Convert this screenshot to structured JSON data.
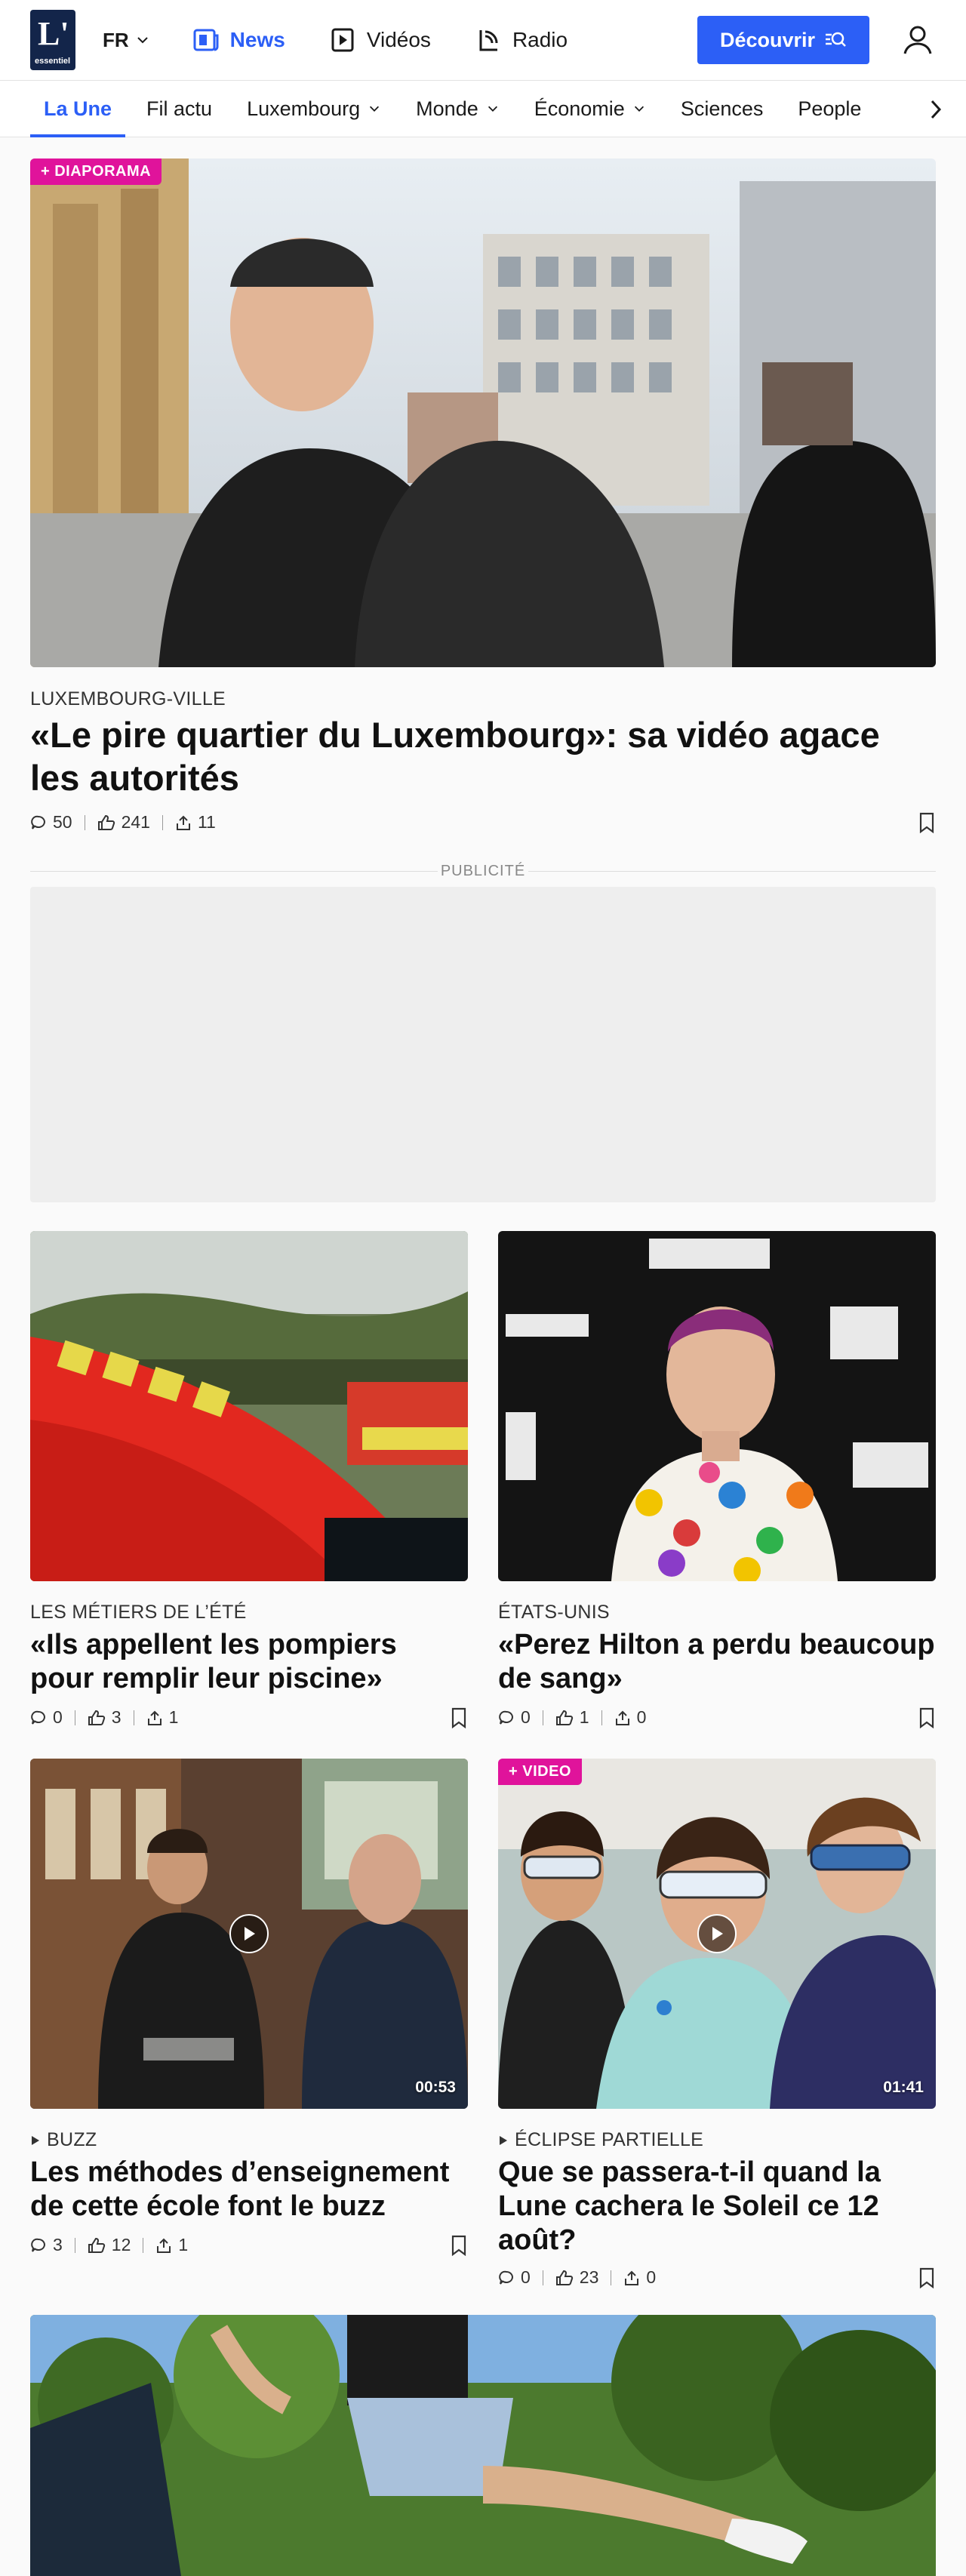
{
  "header": {
    "logo_mark": "L'",
    "logo_word": "essentiel",
    "language": "FR",
    "nav": [
      {
        "label": "News",
        "active": true
      },
      {
        "label": "Vidéos",
        "active": false
      },
      {
        "label": "Radio",
        "active": false
      }
    ],
    "discover_label": "Découvrir"
  },
  "sections": [
    {
      "label": "La Une",
      "active": true,
      "dropdown": false
    },
    {
      "label": "Fil actu",
      "active": false,
      "dropdown": false
    },
    {
      "label": "Luxembourg",
      "active": false,
      "dropdown": true
    },
    {
      "label": "Monde",
      "active": false,
      "dropdown": true
    },
    {
      "label": "Économie",
      "active": false,
      "dropdown": true
    },
    {
      "label": "Sciences",
      "active": false,
      "dropdown": false
    },
    {
      "label": "People",
      "active": false,
      "dropdown": false
    }
  ],
  "lead": {
    "badge": "+ DIAPORAMA",
    "kicker": "LUXEMBOURG-VILLE",
    "headline": "«Le pire quartier du Luxembourg»: sa vidéo agace les autorités",
    "comments": "50",
    "likes": "241",
    "shares": "11"
  },
  "ad_label": "PUBLICITÉ",
  "articles": [
    {
      "kicker": "LES MÉTIERS DE L’ÉTÉ",
      "headline": "«Ils appellent les pompiers pour remplir leur piscine»",
      "comments": "0",
      "likes": "3",
      "shares": "1"
    },
    {
      "kicker": "ÉTATS-UNIS",
      "headline": "«Perez Hilton a perdu beaucoup de sang»",
      "comments": "0",
      "likes": "1",
      "shares": "0"
    },
    {
      "kicker": "BUZZ",
      "headline": "Les méthodes d’enseignement de cette école font le buzz",
      "comments": "3",
      "likes": "12",
      "shares": "1",
      "duration": "00:53"
    },
    {
      "badge": "+ VIDEO",
      "kicker": "ÉCLIPSE PARTIELLE",
      "headline": "Que se passera-t-il quand la Lune cachera le Soleil ce 12 août?",
      "comments": "0",
      "likes": "23",
      "shares": "0",
      "duration": "01:41"
    }
  ],
  "colors": {
    "accent": "#2c5ff6",
    "badge": "#e0139b",
    "logo_bg": "#13254a"
  }
}
